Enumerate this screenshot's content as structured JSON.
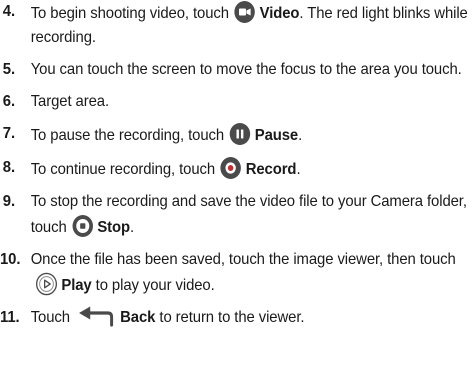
{
  "steps": [
    {
      "number": "4.",
      "before": "To begin shooting video, touch",
      "icon": "video-camera-icon",
      "label": "Video",
      "after": ". The red light blinks while recording."
    },
    {
      "number": "5.",
      "before": "You can touch the screen to move the focus to the area you touch.",
      "icon": null,
      "label": "",
      "after": ""
    },
    {
      "number": "6.",
      "before": "Target area.",
      "icon": null,
      "label": "",
      "after": ""
    },
    {
      "number": "7.",
      "before": "To pause the recording, touch",
      "icon": "pause-icon",
      "label": "Pause",
      "after": "."
    },
    {
      "number": "8.",
      "before": "To continue recording, touch",
      "icon": "record-icon",
      "label": "Record",
      "after": "."
    },
    {
      "number": "9.",
      "before": "To stop the recording and save the video file to your Camera folder, touch",
      "icon": "stop-icon",
      "label": "Stop",
      "after": "."
    },
    {
      "number": "10.",
      "before": "Once the file has been saved, touch the image viewer, then touch",
      "icon": "play-icon",
      "label": "Play",
      "after": " to play your video."
    },
    {
      "number": "11.",
      "before": "Touch",
      "icon": "back-arrow-icon",
      "label": "Back",
      "after": " to return to the viewer."
    }
  ],
  "colors": {
    "text": "#1a1a1a",
    "icon_dark": "#4a4a4a",
    "record_dot": "#c03030"
  }
}
